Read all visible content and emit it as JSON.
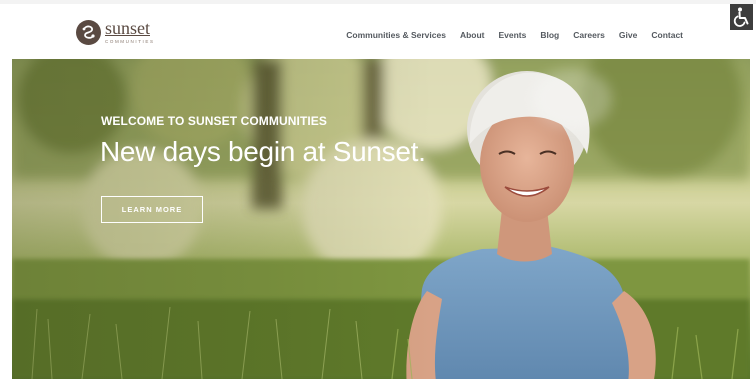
{
  "brand": {
    "name": "sunset",
    "subtitle": "COMMUNITIES",
    "color": "#5a4a42"
  },
  "nav": {
    "items": [
      {
        "label": "Communities & Services"
      },
      {
        "label": "About"
      },
      {
        "label": "Events"
      },
      {
        "label": "Blog"
      },
      {
        "label": "Careers"
      },
      {
        "label": "Give"
      },
      {
        "label": "Contact"
      }
    ]
  },
  "accessibility": {
    "icon": "wheelchair-icon"
  },
  "hero": {
    "eyebrow": "WELCOME TO SUNSET COMMUNITIES",
    "headline": "New days begin at Sunset.",
    "cta_label": "LEARN MORE",
    "image": "smiling-older-woman-sitting-in-grass-photo"
  }
}
